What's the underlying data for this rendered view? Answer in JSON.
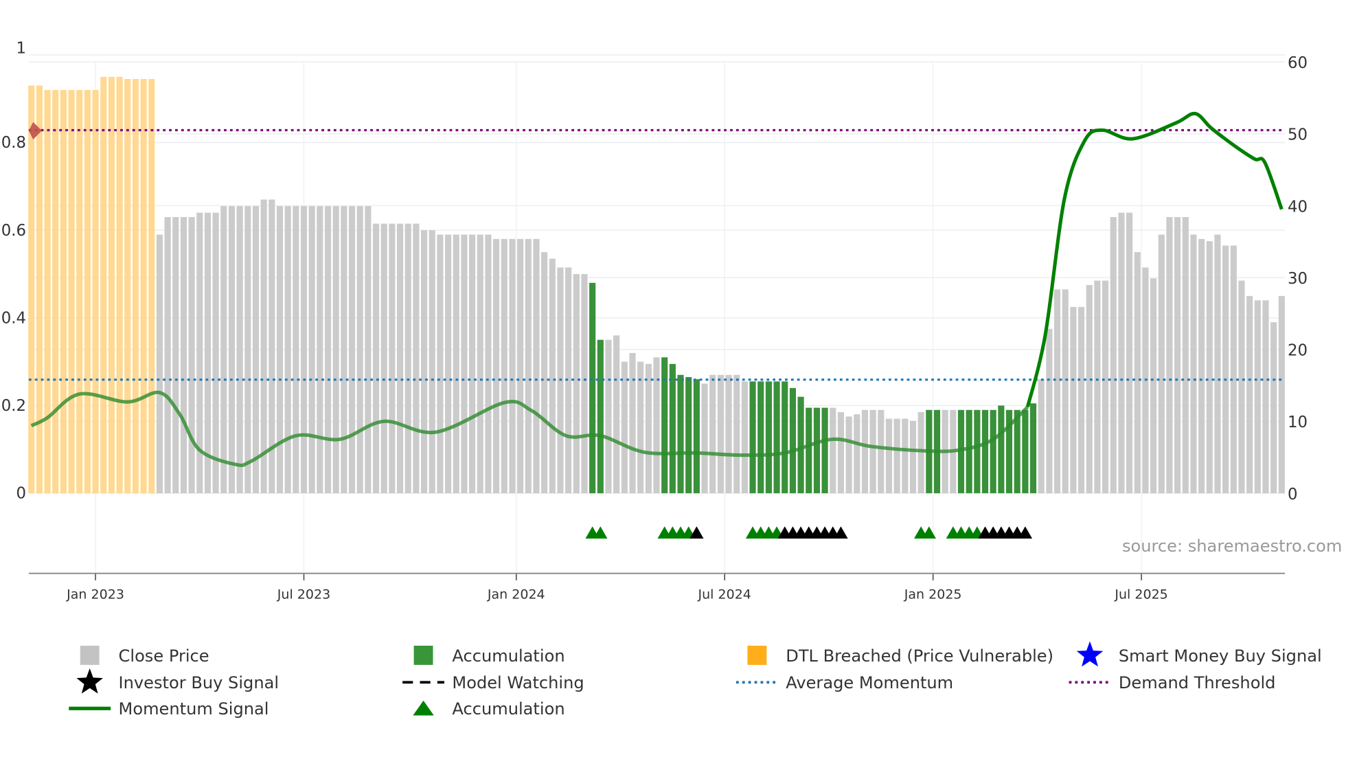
{
  "chart_data": {
    "type": "bar",
    "title": "",
    "source_note": "source: sharemaestro.com",
    "x_ticks": [
      "Jan 2023",
      "Jul 2023",
      "Jan 2024",
      "Jul 2024",
      "Jan 2025",
      "Jul 2025"
    ],
    "x_tick_week_index": [
      8,
      34,
      60.5,
      86.5,
      112.5,
      138.5
    ],
    "left_axis": {
      "ticks": [
        "0",
        "0.2",
        "0.4",
        "0.6",
        "0.8",
        "1"
      ],
      "range": [
        0,
        1
      ]
    },
    "right_axis": {
      "ticks": [
        "0",
        "10",
        "20",
        "30",
        "40",
        "50",
        "60"
      ],
      "range": [
        0,
        60
      ]
    },
    "grid": true,
    "close_price": [
      0.93,
      0.93,
      0.92,
      0.92,
      0.92,
      0.92,
      0.92,
      0.92,
      0.92,
      0.95,
      0.95,
      0.95,
      0.945,
      0.945,
      0.945,
      0.945,
      0.59,
      0.63,
      0.63,
      0.63,
      0.63,
      0.64,
      0.64,
      0.64,
      0.655,
      0.655,
      0.655,
      0.655,
      0.655,
      0.67,
      0.67,
      0.655,
      0.655,
      0.655,
      0.655,
      0.655,
      0.655,
      0.655,
      0.655,
      0.655,
      0.655,
      0.655,
      0.655,
      0.615,
      0.615,
      0.615,
      0.615,
      0.615,
      0.615,
      0.6,
      0.6,
      0.59,
      0.59,
      0.59,
      0.59,
      0.59,
      0.59,
      0.59,
      0.58,
      0.58,
      0.58,
      0.58,
      0.58,
      0.58,
      0.55,
      0.535,
      0.515,
      0.515,
      0.5,
      0.5,
      0.48,
      0.35,
      0.35,
      0.36,
      0.3,
      0.32,
      0.3,
      0.295,
      0.31,
      0.31,
      0.295,
      0.27,
      0.265,
      0.26,
      0.25,
      0.27,
      0.27,
      0.27,
      0.27,
      0.255,
      0.255,
      0.255,
      0.255,
      0.255,
      0.255,
      0.24,
      0.22,
      0.195,
      0.195,
      0.195,
      0.195,
      0.185,
      0.175,
      0.18,
      0.19,
      0.19,
      0.19,
      0.17,
      0.17,
      0.17,
      0.165,
      0.185,
      0.19,
      0.19,
      0.19,
      0.19,
      0.19,
      0.19,
      0.19,
      0.19,
      0.19,
      0.2,
      0.19,
      0.19,
      0.19,
      0.205,
      0.26,
      0.375,
      0.465,
      0.465,
      0.425,
      0.425,
      0.475,
      0.485,
      0.485,
      0.63,
      0.64,
      0.64,
      0.55,
      0.515,
      0.49,
      0.59,
      0.63,
      0.63,
      0.63,
      0.59,
      0.58,
      0.575,
      0.59,
      0.565,
      0.565,
      0.485,
      0.45,
      0.44,
      0.44,
      0.39,
      0.45
    ],
    "bar_state": "DDDDDDDDDDDDDDDDCCCCCCCCCCCCCCCCCCCCCCCCCCCCCCCCCCCCCCCCCCCCCCCCCCCCCCAACCCCCCCAAAAACCCCCCAAAAAAAAAACCCCCCCCCCCCAACCAAAAAAAAAACCCCCCCCCCCCCCCCCCCCCCCCCCCCCCCC",
    "bar_state_legend": {
      "C": "Close Price",
      "A": "Accumulation",
      "D": "DTL Breached (Price Vulnerable)"
    },
    "momentum_signal": {
      "week_index": [
        0,
        2,
        6,
        12,
        16,
        18.5,
        21,
        25.5,
        27.5,
        33,
        38.5,
        44,
        50.5,
        59,
        62.4,
        66.7,
        71,
        76.5,
        83,
        88.5,
        94,
        99.9,
        104.8,
        111.3,
        115.7,
        120,
        124.3,
        126.5,
        128.9,
        131.4,
        133.6,
        137.4,
        142.8,
        145.2,
        147.2,
        149.9,
        152.6,
        153.9,
        156
      ],
      "values": [
        9.4,
        10.5,
        13.8,
        12.7,
        14,
        11,
        6,
        4,
        4.5,
        8,
        7.5,
        10,
        8.5,
        12.6,
        11.5,
        8,
        8,
        5.7,
        5.6,
        5.3,
        5.6,
        7.5,
        6.5,
        5.9,
        6,
        7.5,
        12,
        22,
        41,
        49,
        50.5,
        49.3,
        51.5,
        52.8,
        50.8,
        48.5,
        46.5,
        46,
        39.5
      ],
      "axis": "right"
    },
    "average_momentum": 15.8,
    "demand_threshold": 50.5,
    "accumulation_markers": {
      "green": [
        70,
        71,
        79,
        80,
        81,
        82,
        90,
        91,
        92,
        93,
        111,
        112,
        115,
        116,
        117,
        118
      ],
      "black": [
        83,
        94,
        95,
        96,
        97,
        98,
        99,
        100,
        101,
        119,
        120,
        121,
        122,
        123,
        124
      ]
    },
    "legend": [
      {
        "label": "Close Price",
        "marker": "square",
        "color": "#bdbdbd"
      },
      {
        "label": "Accumulation",
        "marker": "square",
        "color": "#228b22"
      },
      {
        "label": "DTL Breached (Price Vulnerable)",
        "marker": "square",
        "color": "#ffa500"
      },
      {
        "label": "Smart Money Buy Signal",
        "marker": "star",
        "color": "#0000ff"
      },
      {
        "label": "Investor Buy Signal",
        "marker": "star",
        "color": "#000000"
      },
      {
        "label": "Model Watching",
        "marker": "dash",
        "color": "#000000"
      },
      {
        "label": "Average Momentum",
        "marker": "dotted",
        "color": "#1f77b4"
      },
      {
        "label": "Demand Threshold",
        "marker": "dotted",
        "color": "#800080"
      },
      {
        "label": "Momentum Signal",
        "marker": "line",
        "color": "#008000"
      },
      {
        "label": "Accumulation",
        "marker": "triangle",
        "color": "#008000"
      }
    ],
    "colors": {
      "close": "#c8c8c8",
      "accum": "#2e8b2e",
      "dtl": "#ffd68c",
      "momentum": "#008000",
      "avg": "#1f77b4",
      "threshold": "#800080"
    }
  }
}
